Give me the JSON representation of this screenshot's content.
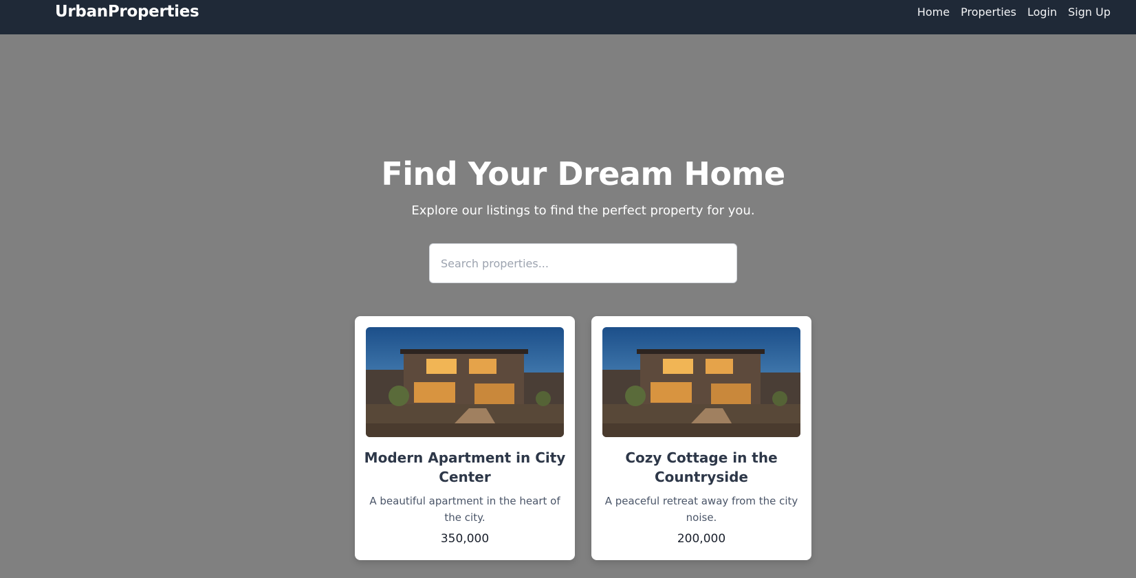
{
  "navbar": {
    "brand": "UrbanProperties",
    "links": [
      "Home",
      "Properties",
      "Login",
      "Sign Up"
    ]
  },
  "hero": {
    "title": "Find Your Dream Home",
    "subtitle": "Explore our listings to find the perfect property for you.",
    "search_placeholder": "Search properties..."
  },
  "listings": [
    {
      "title": "Modern Apartment in City Center",
      "description": "A beautiful apartment in the heart of the city.",
      "price": "350,000"
    },
    {
      "title": "Cozy Cottage in the Countryside",
      "description": "A peaceful retreat away from the city noise.",
      "price": "200,000"
    }
  ],
  "colors": {
    "navbar_bg": "#1f2937",
    "page_bg": "#808080",
    "card_bg": "#ffffff",
    "title_text": "#2d3748"
  }
}
